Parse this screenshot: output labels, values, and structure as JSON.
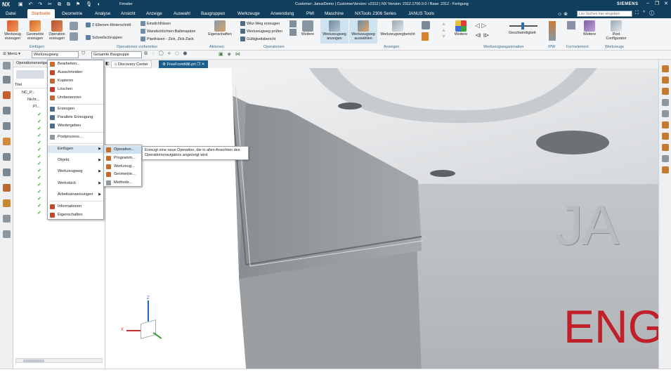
{
  "titlebar": {
    "app": "NX",
    "quick_access": "Fenster",
    "status": "Customer: JanusDemo | CustomerVersion: v2312 | NX Version: 2312.1700.0.0 / Base: 2312 - Fertigung",
    "brand": "SIEMENS"
  },
  "menu": {
    "items": [
      "Datei",
      "Startseite",
      "Geometrie",
      "Analyse",
      "Ansicht",
      "Anzeige",
      "Auswahl",
      "Baugruppen",
      "Werkzeuge",
      "Anwendung",
      "PMI",
      "Maschine",
      "NXTools 2306 Series",
      "JANUS Tools"
    ],
    "active": "Startseite",
    "search_placeholder": "Los Suchen hier eingeben"
  },
  "ribbon": {
    "big_buttons": [
      {
        "label": "Werkzeug\nerzeugen",
        "icon": "tool-create-icon"
      },
      {
        "label": "Geometrie\nerzeugen",
        "icon": "geometry-create-icon"
      },
      {
        "label": "Operation\nerzeugen",
        "icon": "operation-create-icon"
      },
      {
        "label": "Eigenschaften",
        "icon": "properties-icon"
      },
      {
        "label": "Weitere",
        "icon": "more-icon"
      },
      {
        "label": "Werkzeugweg\nanzeigen",
        "icon": "toolpath-show-icon"
      },
      {
        "label": "Werkzeugweg\nauswählen",
        "icon": "toolpath-select-icon"
      },
      {
        "label": "Werkzeugwegbericht",
        "icon": "toolpath-report-icon"
      },
      {
        "label": "Weitere",
        "icon": "more-icon"
      },
      {
        "label": "Weitere",
        "icon": "more-icon"
      },
      {
        "label": "Post\nConfigurator",
        "icon": "post-configurator-icon"
      }
    ],
    "small_items": {
      "z_ebenen": "Z-Ebenen-Hinterschnitt",
      "schnell": "Schnellschruppen",
      "einstich": "Einstichfräsen",
      "wand": "Wandschlichten-Ballenspäne",
      "plan": "Planfräsen - Zick, Zick-Zack",
      "wkz_weg": "Wkz-Weg erzeugen",
      "pruefen": "Werkzeugweg prüfen",
      "gueltig": "Gültigkeitsbericht",
      "weitere": "Weitere",
      "geschw": "Geschwindigkeit"
    },
    "groups": [
      "Einfügen",
      "Operationen vorbereiten",
      "Aktionen",
      "Operationen",
      "Anzeigen",
      "Werkzeugweganimation",
      "IPW",
      "Formelement",
      "Werkzeuge"
    ]
  },
  "quickbar": {
    "menu_label": "Menü",
    "filter_value": "Werkzeugweg",
    "scope_value": "Gesamte Baugruppe"
  },
  "nav": {
    "title": "Operationsnavigator",
    "col_title": "Titel",
    "tree": [
      "NC_P...",
      "Nicht...",
      "PI...",
      "..."
    ]
  },
  "tabs": [
    {
      "label": "Discovery Center",
      "active": false
    },
    {
      "label": "FreeFromMill.prt",
      "active": true
    }
  ],
  "context_menu": {
    "items": [
      {
        "label": "Bearbeiten...",
        "icon": "edit-icon"
      },
      {
        "label": "Ausschneiden",
        "icon": "cut-icon"
      },
      {
        "label": "Kopieren",
        "icon": "copy-icon"
      },
      {
        "label": "Löschen",
        "icon": "delete-icon"
      },
      {
        "label": "Umbenennen",
        "icon": "rename-icon"
      },
      {
        "label": "Erzeugen",
        "icon": "generate-icon"
      },
      {
        "label": "Parallele Erzeugung",
        "icon": "parallel-generate-icon"
      },
      {
        "label": "Wiedergeben",
        "icon": "replay-icon"
      },
      {
        "label": "Postprozess...",
        "icon": "postprocess-icon"
      },
      {
        "label": "Einfügen",
        "icon": "",
        "sub": true
      },
      {
        "label": "Objekt",
        "icon": "",
        "sub": true
      },
      {
        "label": "Werkzeugweg",
        "icon": "",
        "sub": true
      },
      {
        "label": "Werkstück",
        "icon": "",
        "sub": true
      },
      {
        "label": "Arbeitsanweisungen",
        "icon": "",
        "sub": true
      },
      {
        "label": "Informationen",
        "icon": "info-icon"
      },
      {
        "label": "Eigenschaften",
        "icon": "properties-icon"
      }
    ]
  },
  "submenu": {
    "items": [
      {
        "label": "Operation...",
        "icon": "operation-icon"
      },
      {
        "label": "Programm...",
        "icon": "program-icon"
      },
      {
        "label": "Werkzeug...",
        "icon": "tool-icon"
      },
      {
        "label": "Geometrie...",
        "icon": "geometry-icon"
      },
      {
        "label": "Methode...",
        "icon": "method-icon"
      }
    ]
  },
  "tooltip": {
    "text": "Erzeugt eine neue Operation, die in allen Ansichten des Operationsnavigators angezeigt wird."
  },
  "viewport": {
    "engraving_top": "JA",
    "engraving_bottom": "ENG",
    "axis_z": "Z",
    "axis_x": "X"
  },
  "colors": {
    "titlebar": "#113e5c",
    "accent": "#d4530a",
    "selection": "#2d6ea3",
    "engrave_red": "#c0202a"
  }
}
